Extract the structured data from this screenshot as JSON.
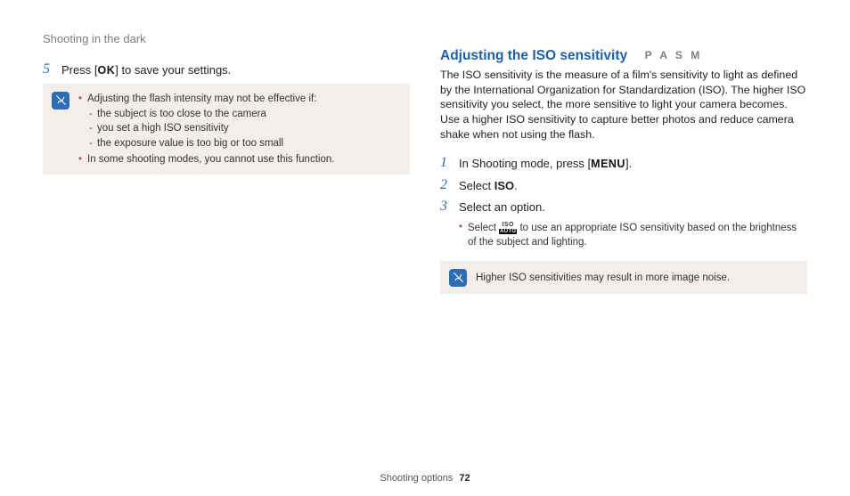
{
  "breadcrumb": "Shooting in the dark",
  "left": {
    "step5": {
      "num": "5",
      "prefix": "Press [",
      "btn": "OK",
      "suffix": "] to save your settings."
    },
    "note": {
      "bullet1": "Adjusting the flash intensity may not be effective if:",
      "d1": "the subject is too close to the camera",
      "d2": "you set a high ISO sensitivity",
      "d3": "the exposure value is too big or too small",
      "bullet2": "In some shooting modes, you cannot use this function."
    }
  },
  "right": {
    "title": "Adjusting the ISO sensitivity",
    "modes": "P A S M",
    "para": "The ISO sensitivity is the measure of a film's sensitivity to light as defined by the International Organization for Standardization (ISO). The higher ISO sensitivity you select, the more sensitive to light your camera becomes. Use a higher ISO sensitivity to capture better photos and reduce camera shake when not using the flash.",
    "step1": {
      "num": "1",
      "prefix": "In Shooting mode, press [",
      "btn": "MENU",
      "suffix": "]."
    },
    "step2": {
      "num": "2",
      "prefix": "Select ",
      "bold": "ISO",
      "suffix": "."
    },
    "step3": {
      "num": "3",
      "text": "Select an option."
    },
    "sub": {
      "pre": "Select ",
      "iso_top": "ISO",
      "iso_bot": "AUTO",
      "post": " to use an appropriate ISO sensitivity based on the brightness of the subject and lighting."
    },
    "note": "Higher ISO sensitivities may result in more image noise."
  },
  "footer": {
    "label": "Shooting options",
    "page": "72"
  }
}
